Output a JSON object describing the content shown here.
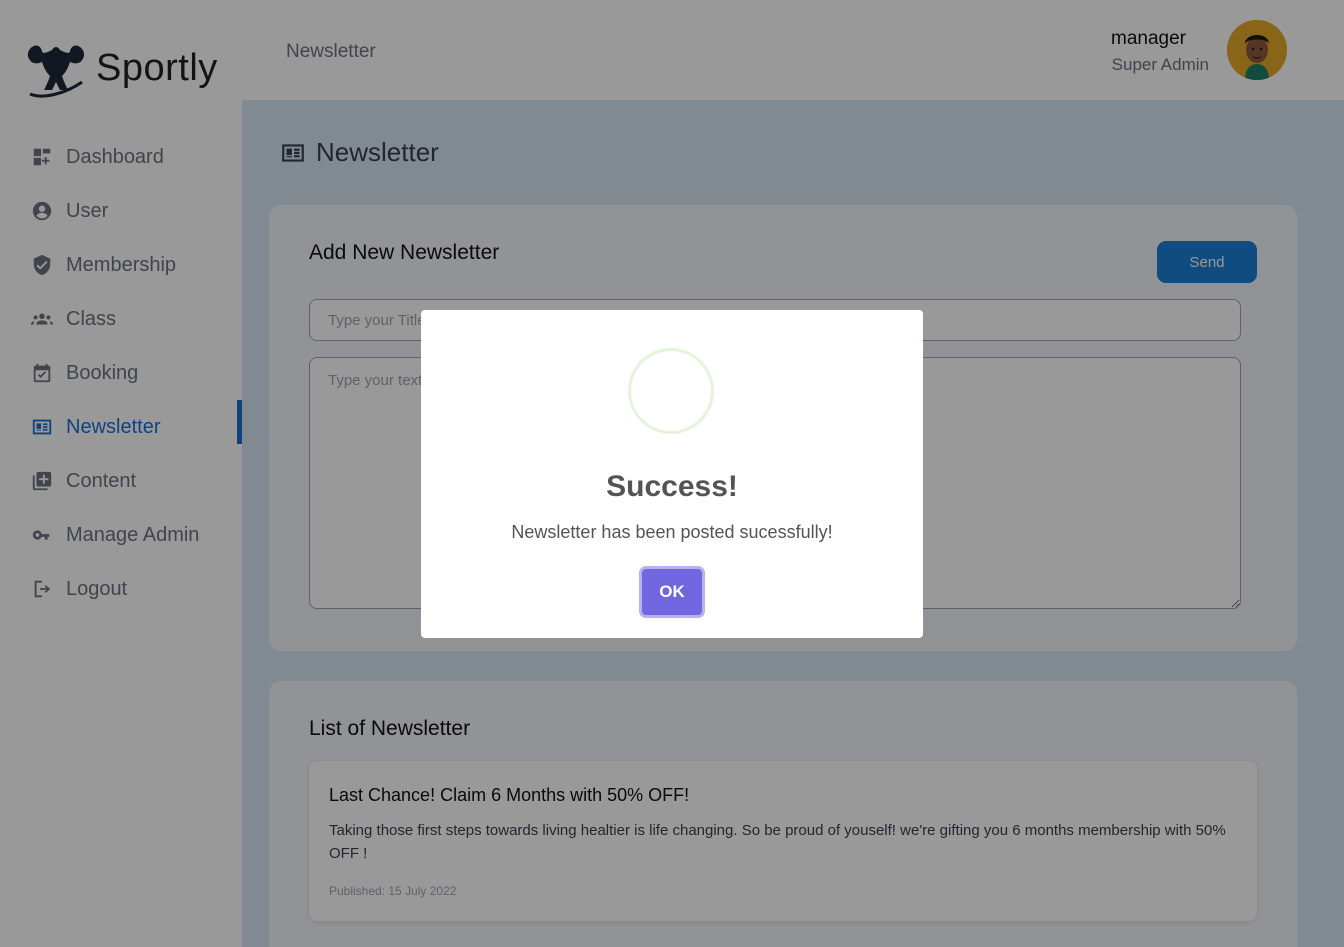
{
  "app": {
    "name": "Sportly"
  },
  "header": {
    "title": "Newsletter",
    "user_name": "manager",
    "user_role": "Super Admin"
  },
  "sidebar": {
    "items": [
      {
        "label": "Dashboard",
        "icon": "dashboard-icon"
      },
      {
        "label": "User",
        "icon": "user-circle-icon"
      },
      {
        "label": "Membership",
        "icon": "shield-check-icon"
      },
      {
        "label": "Class",
        "icon": "group-icon"
      },
      {
        "label": "Booking",
        "icon": "calendar-check-icon"
      },
      {
        "label": "Newsletter",
        "icon": "newspaper-icon",
        "active": true
      },
      {
        "label": "Content",
        "icon": "library-add-icon"
      },
      {
        "label": "Manage Admin",
        "icon": "key-icon"
      },
      {
        "label": "Logout",
        "icon": "logout-icon"
      }
    ]
  },
  "main": {
    "page_title": "Newsletter",
    "add_card": {
      "heading": "Add New Newsletter",
      "send_label": "Send",
      "title_placeholder": "Type your Title",
      "text_placeholder": "Type your text"
    },
    "list_card": {
      "heading": "List of Newsletter",
      "items": [
        {
          "title": "Last Chance! Claim 6 Months with 50% OFF!",
          "body": "Taking those first steps towards living healtier is life changing. So be proud of youself! we're gifting you 6 months membership with 50% OFF !",
          "date": "Published: 15 July 2022"
        }
      ]
    }
  },
  "modal": {
    "title": "Success!",
    "message": "Newsletter has been posted sucessfully!",
    "ok_label": "OK",
    "icon": "success-icon"
  },
  "colors": {
    "accent": "#1e6fd0",
    "modal_button": "#7066e0",
    "main_bg": "#d9e6f2"
  }
}
